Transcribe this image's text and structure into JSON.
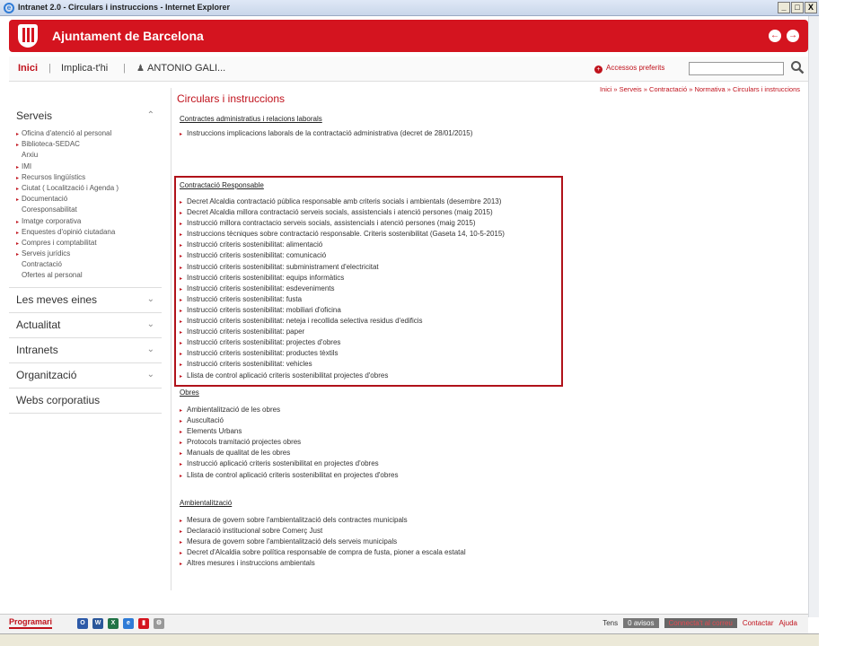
{
  "window": {
    "title": "Intranet 2.0 - Circulars i instruccions - Internet Explorer",
    "buttons": [
      "_",
      "□",
      "X"
    ]
  },
  "header": {
    "brand": "Ajuntament de Barcelona",
    "back": "←",
    "forward": "→",
    "accent": "#d4141f"
  },
  "nav": {
    "inici": "Inici",
    "sep": "|",
    "implica": "Implica-t'hi",
    "user": "ANTONIO GALI...",
    "favorites": "Accessos preferits",
    "search_value": ""
  },
  "breadcrumb": "Inici » Serveis » Contractació » Normativa » Circulars i instruccions",
  "sidebar": {
    "serveis": {
      "title": "Serveis",
      "items": [
        {
          "label": "Oficina d'atenció al personal",
          "sub": false
        },
        {
          "label": "Biblioteca-SEDAC",
          "sub": false
        },
        {
          "label": "Arxiu",
          "sub": true
        },
        {
          "label": "IMI",
          "sub": false
        },
        {
          "label": "Recursos lingüístics",
          "sub": false
        },
        {
          "label": "Ciutat ( Localització i Agenda )",
          "sub": false
        },
        {
          "label": "Documentació",
          "sub": false
        },
        {
          "label": "Coresponsabilitat",
          "sub": true
        },
        {
          "label": "Imatge corporativa",
          "sub": false
        },
        {
          "label": "Enquestes d'opinió ciutadana",
          "sub": false
        },
        {
          "label": "Compres i comptabilitat",
          "sub": false
        },
        {
          "label": "Serveis jurídics",
          "sub": false
        },
        {
          "label": "Contractació",
          "sub": true
        },
        {
          "label": "Ofertes al personal",
          "sub": true
        }
      ]
    },
    "sections": [
      "Les meves eines",
      "Actualitat",
      "Intranets",
      "Organització",
      "Webs corporatius"
    ]
  },
  "main": {
    "title": "Circulars i instruccions",
    "sections": [
      {
        "title": "Contractes administratius i relacions laborals",
        "links": [
          "Instruccions implicacions laborals de la contractació administrativa (decret de 28/01/2015)"
        ]
      },
      {
        "title": "Contractació Responsable",
        "links": [
          "Decret Alcaldia contractació pública responsable amb criteris socials i ambientals (desembre 2013)",
          "Decret Alcaldia millora contractació serveis socials, assistencials i atenció persones (maig 2015)",
          "Instrucció millora contractacio serveis socials, assistencials i atenció persones (maig 2015)",
          "Instruccions tècniques sobre contractació responsable. Criteris sostenibilitat (Gaseta 14, 10-5-2015)",
          "Instrucció criteris sostenibilitat: alimentació",
          "Instrucció criteris sostenibilitat: comunicació",
          "Instrucció criteris sostenibilitat: subministrament d'electricitat",
          "Instrucció criteris sostenibilitat: equips informàtics",
          "Instrucció criteris sostenibilitat: esdeveniments",
          "Instrucció criteris sostenibilitat: fusta",
          "Instrucció criteris sostenibilitat: mobiliari d'oficina",
          "Instrucció criteris sostenibilitat: neteja i recollida selectiva residus d'edificis",
          "Instrucció criteris sostenibilitat: paper",
          "Instrucció criteris sostenibilitat: projectes d'obres",
          "Instrucció criteris sostenibilitat: productes tèxtils",
          "Instrucció criteris sostenibilitat: vehicles",
          "Llista de control aplicació criteris sostenibilitat projectes d'obres"
        ]
      },
      {
        "title": "Obres",
        "links": [
          "Ambientalització de les obres",
          "Auscultació",
          "Elements Urbans",
          "Protocols tramitació projectes obres",
          "Manuals de qualitat de les obres",
          "Instrucció aplicació criteris sostenibilitat en projectes d'obres",
          "Llista de control aplicació criteris sostenibilitat en projectes d'obres"
        ]
      },
      {
        "title": "Ambientalització",
        "links": [
          "Mesura de govern sobre l'ambientalització dels contractes municipals",
          "Declaració institucional sobre Comerç Just",
          "Mesura de govern sobre l'ambientalització dels serveis municipals",
          "Decret d'Alcaldia sobre política responsable de compra de fusta, pioner a escala estatal",
          "Altres mesures i instruccions ambientals"
        ]
      }
    ]
  },
  "bottom": {
    "programari": "Programari",
    "tens": "Tens",
    "avisos": "0 avisos",
    "connecta": "Connecta't al correu",
    "contactar": "Contactar",
    "ajuda": "Ajuda"
  }
}
